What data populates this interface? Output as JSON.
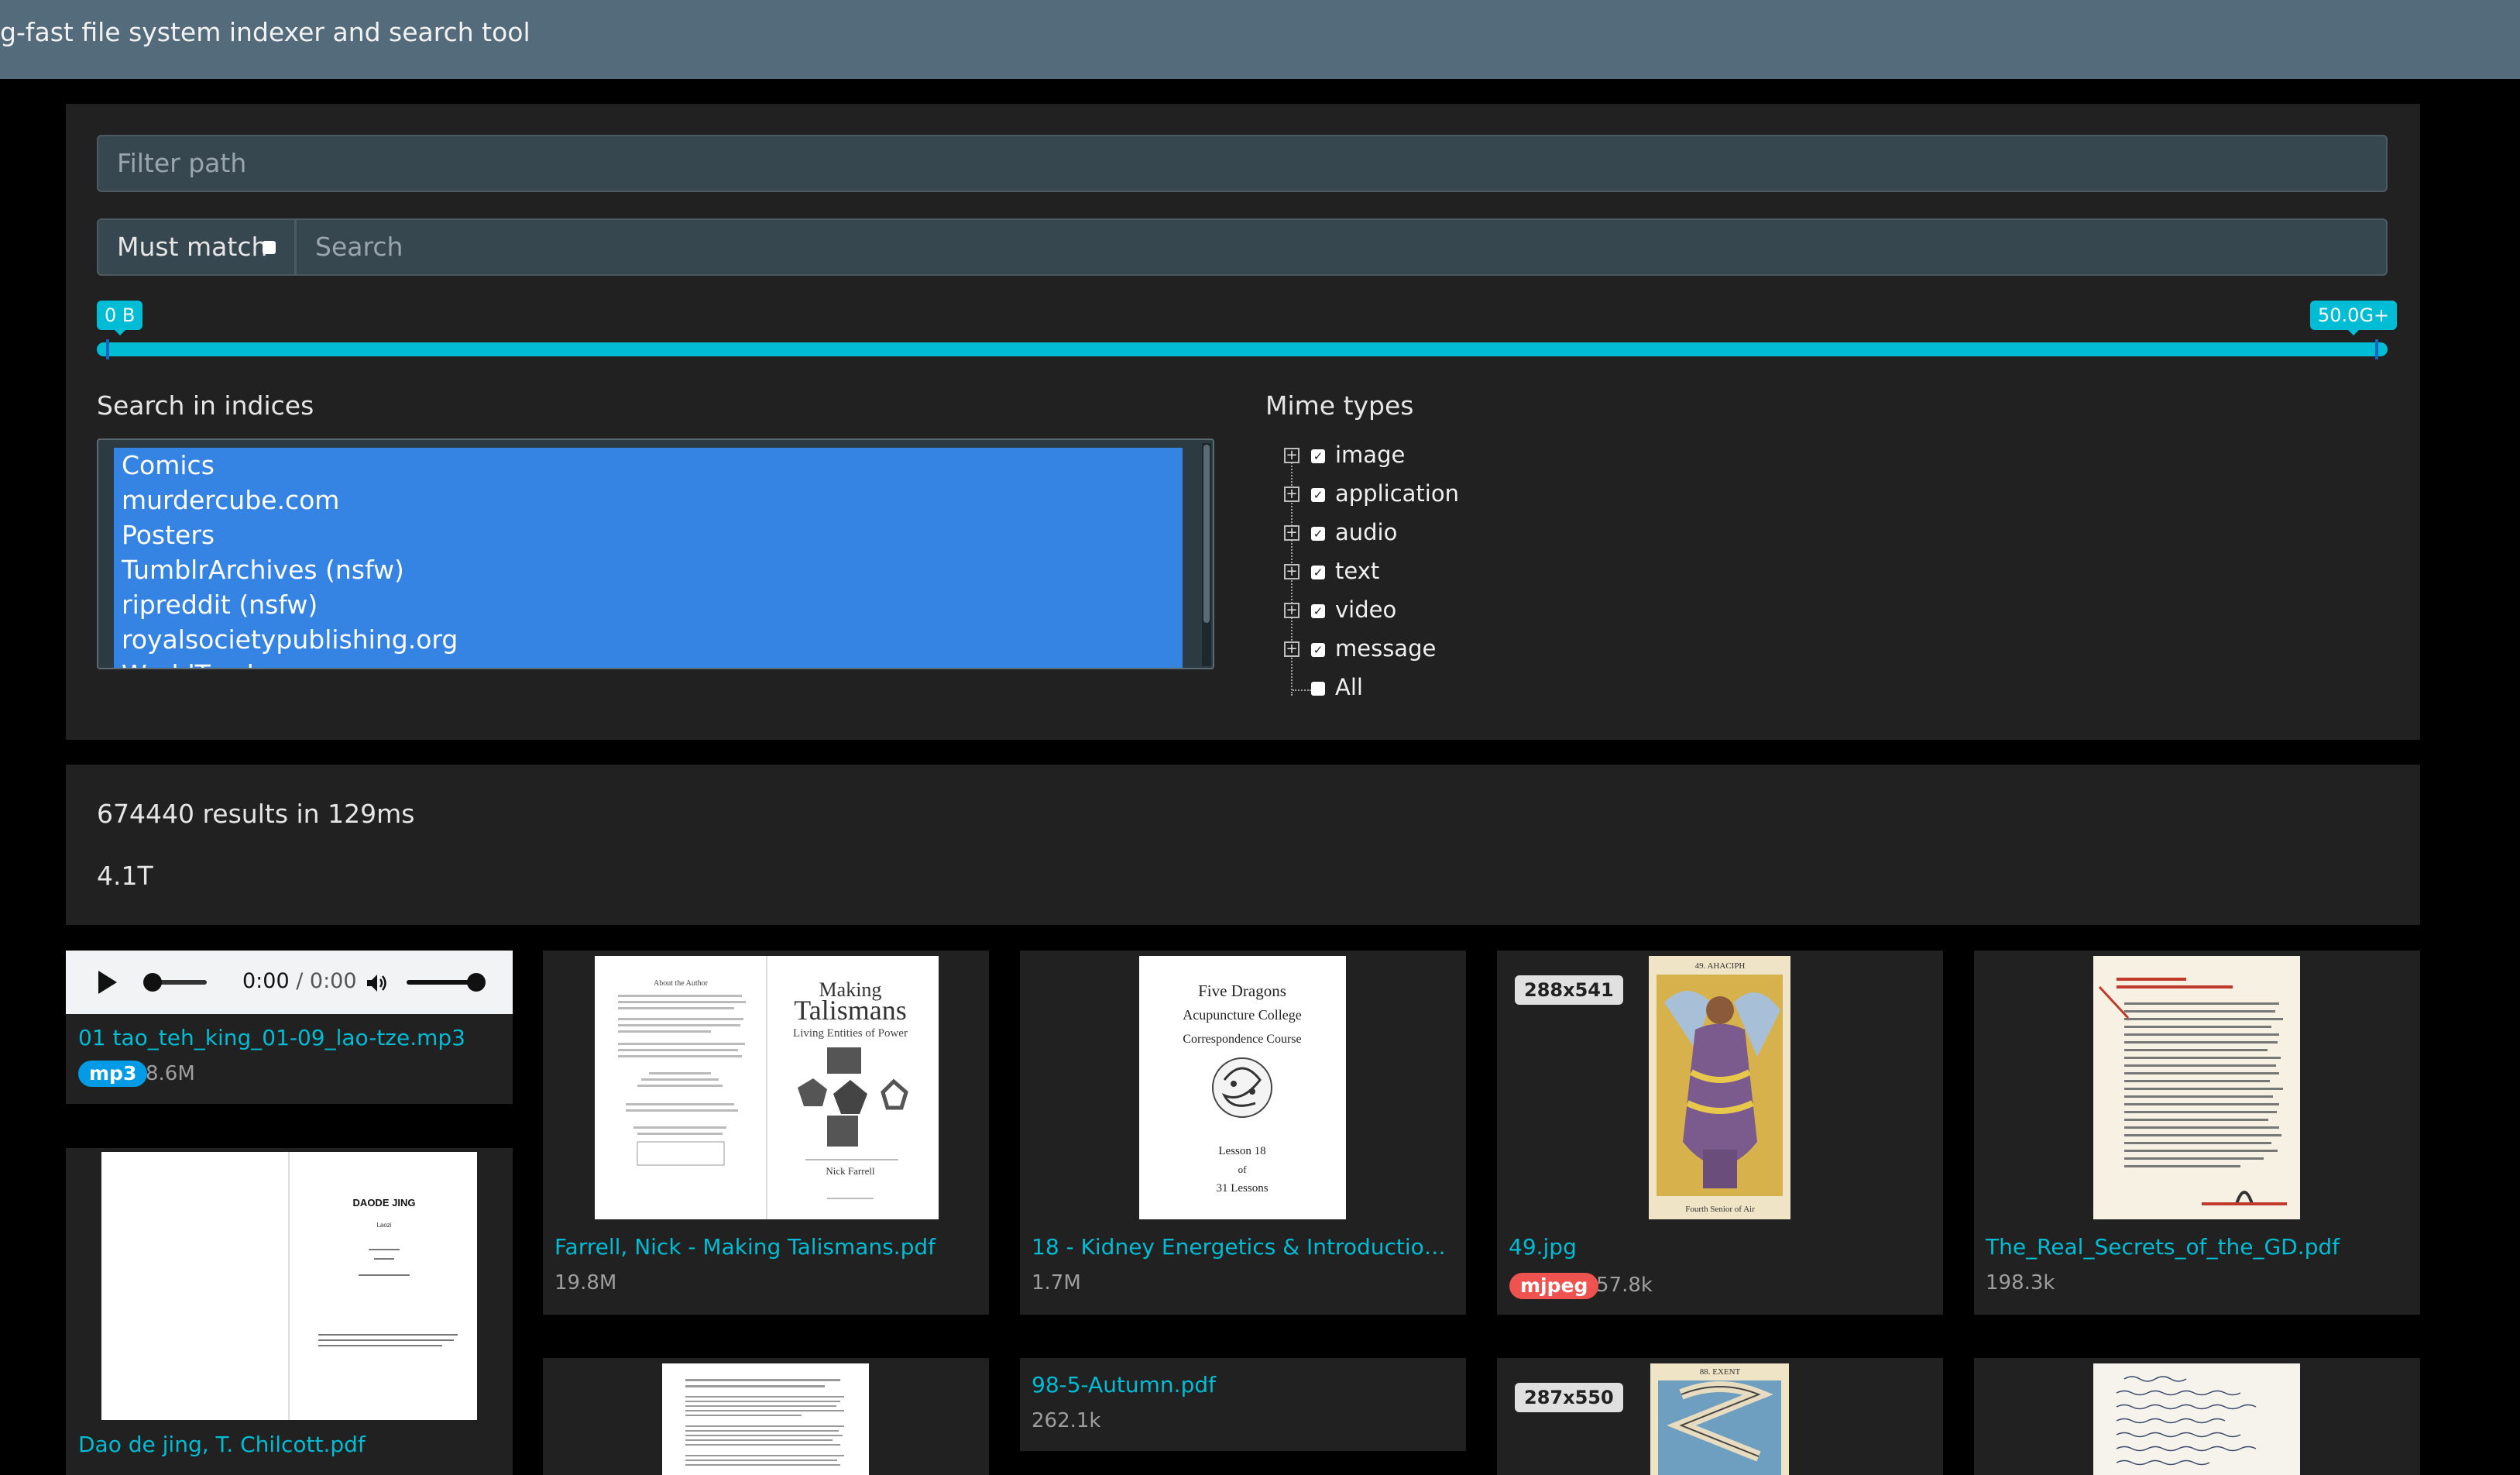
{
  "app": {
    "title": "g-fast file system indexer and search tool"
  },
  "search": {
    "filter_placeholder": "Filter path",
    "must_match_label": "Must match",
    "search_placeholder": "Search",
    "size_min_label": "0 B",
    "size_max_label": "50.0G+",
    "size_range_fraction": [
      0.0,
      1.0
    ]
  },
  "indices": {
    "label": "Search in indices",
    "items": [
      "Comics",
      "murdercube.com",
      "Posters",
      "TumblrArchives (nsfw)",
      "ripreddit (nsfw)",
      "royalsocietypublishing.org",
      "WorldTracker"
    ]
  },
  "mime": {
    "label": "Mime types",
    "items": [
      {
        "label": "image",
        "checked": true,
        "expandable": true
      },
      {
        "label": "application",
        "checked": true,
        "expandable": true
      },
      {
        "label": "audio",
        "checked": true,
        "expandable": true
      },
      {
        "label": "text",
        "checked": true,
        "expandable": true
      },
      {
        "label": "video",
        "checked": true,
        "expandable": true
      },
      {
        "label": "message",
        "checked": true,
        "expandable": true
      },
      {
        "label": "All",
        "checked": false,
        "expandable": false
      }
    ]
  },
  "results": {
    "count_text": "674440 results in 129ms",
    "total_size": "4.1T"
  },
  "cards": [
    {
      "name": "01 tao_teh_king_01-09_lao-tze.mp3",
      "badge": "mp3",
      "badge_color": "#039be5",
      "size": "8.6M",
      "audio": {
        "current": "0:00",
        "separator": " / ",
        "duration": "0:00"
      }
    },
    {
      "name": "Farrell, Nick - Making Talismans.pdf",
      "size": "19.8M",
      "thumb_title_1": "Making",
      "thumb_title_2": "Talismans",
      "thumb_sub": "Living Entities of Power",
      "thumb_author": "Nick Farrell",
      "thumb_left_head": "About the Author"
    },
    {
      "name": "18 - Kidney Energetics & Introduction to P...",
      "size": "1.7M",
      "thumb_lines": [
        "Five Dragons",
        "Acupuncture College",
        "Correspondence Course"
      ],
      "thumb_lesson": [
        "Lesson 18",
        "of",
        "31 Lessons"
      ]
    },
    {
      "name": "49.jpg",
      "badge": "mjpeg",
      "badge_color": "#ef5350",
      "size": "57.8k",
      "resolution": "288x541",
      "thumb_caption": "Fourth Senior of Air",
      "thumb_top": "49. AHACIPH"
    },
    {
      "name": "The_Real_Secrets_of_the_GD.pdf",
      "size": "198.3k"
    },
    {
      "name": "Dao de jing, T. Chilcott.pdf",
      "thumb_title": "DAODE JING",
      "thumb_sub": "Laozi"
    },
    {
      "name": "98-5-Autumn.pdf",
      "size": "262.1k"
    },
    {
      "resolution": "287x550",
      "thumb_top": "88. EXENT"
    }
  ],
  "colors": {
    "accent": "#00bcd4",
    "header": "#536b7b",
    "panel": "#212121",
    "selection": "#3584e4"
  }
}
